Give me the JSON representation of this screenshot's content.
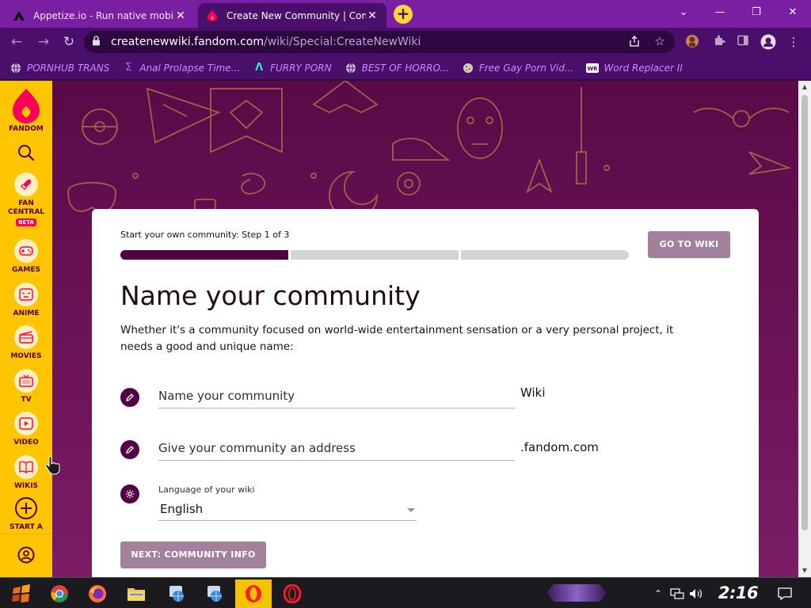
{
  "browser": {
    "tabs": [
      {
        "title": "Appetize.io - Run native mobile",
        "active": false
      },
      {
        "title": "Create New Community | Comm",
        "active": true
      }
    ],
    "new_tab_label": "+",
    "window_controls": {
      "minimize": "—",
      "restore": "❐",
      "close": "✕",
      "tab_search": "⌄"
    },
    "url_host": "createnewwiki.fandom.com",
    "url_path": "/wiki/Special:CreateNewWiki",
    "bookmarks": [
      {
        "label": "PORNHUB TRANS",
        "icon": "globe-icon"
      },
      {
        "label": "Anal Prolapse Time...",
        "icon": "sigma-icon"
      },
      {
        "label": "FURRY PORN",
        "icon": "arrow-a-icon"
      },
      {
        "label": "BEST OF HORRO...",
        "icon": "globe-icon"
      },
      {
        "label": "Free Gay Porn Vid...",
        "icon": "cookie-icon"
      },
      {
        "label": "Word Replacer II",
        "icon": "wr-icon"
      }
    ]
  },
  "sidebar": {
    "brand": "FANDOM",
    "items": [
      {
        "label": "FAN\nCENTRAL",
        "badge": "BETA",
        "icon": "rocket-icon"
      },
      {
        "label": "GAMES",
        "icon": "gamepad-icon"
      },
      {
        "label": "ANIME",
        "icon": "anime-face-icon"
      },
      {
        "label": "MOVIES",
        "icon": "clapperboard-icon"
      },
      {
        "label": "TV",
        "icon": "tv-icon"
      },
      {
        "label": "VIDEO",
        "icon": "play-icon"
      },
      {
        "label": "WIKIS",
        "icon": "book-icon"
      },
      {
        "label": "START A\nWIKI",
        "icon": "plus-circle-icon"
      }
    ]
  },
  "card": {
    "step_label": "Start your own community: Step 1 of 3",
    "progress": {
      "current": 1,
      "total": 3
    },
    "goto_label": "GO TO WIKI",
    "heading": "Name your community",
    "description": "Whether it's a community focused on world-wide entertainment sensation or a very personal project, it needs a good and unique name:",
    "name_placeholder": "Name your community",
    "name_suffix": "Wiki",
    "address_placeholder": "Give your community an address",
    "address_suffix": ".fandom.com",
    "language_label": "Language of your wiki",
    "language_value": "English",
    "next_label": "NEXT: COMMUNITY INFO"
  },
  "taskbar": {
    "clock": "2:16 PM"
  },
  "colors": {
    "fandom_yellow": "#ffc500",
    "fandom_purple": "#520044",
    "button_disabled": "#a3809b",
    "browser_purple": "#4a0e6b"
  }
}
